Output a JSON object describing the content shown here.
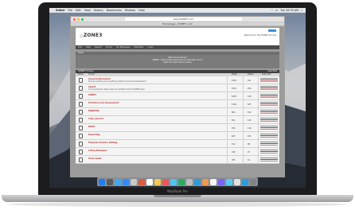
{
  "menubar": {
    "apple_icon": "apple-icon",
    "app": "Safari",
    "items": [
      "File",
      "Edit",
      "View",
      "History",
      "Bookmarks",
      "Window",
      "Help"
    ],
    "clock": "Tue 10:53 AM"
  },
  "browser": {
    "url": "www.ZONE3.com",
    "tab": "Homepage - ZONE3 .com"
  },
  "site": {
    "logo": "ZONE3",
    "welcome": "Welcome to the ZONE3 forums",
    "nav": [
      "FAQ",
      "Help",
      "Search",
      "Forum",
      "My Messages",
      "Members",
      "Login"
    ],
    "news_label": "News",
    "banner_lines": [
      "Welcome to Zone3!",
      "ZONE3 - Personal Development and Self Help Forum",
      "Read the rules before posting"
    ],
    "forum_title": "ZONE3 Forums",
    "forum_title_right": "Last Post",
    "columns": {
      "status": "Status",
      "forum": "Forum",
      "posts": "Posts",
      "topics": "Topics",
      "last_post": "Last post"
    }
  },
  "forums": [
    {
      "title": "General Discussion",
      "desc": "Discuss anything and everything related to personal development",
      "posts": "2345",
      "topics": "411"
    },
    {
      "title": "Latest",
      "desc": "Announcements, latest news and updates from the ZONE3 team",
      "posts": "1521",
      "topics": "254"
    },
    {
      "title": "ZONE3",
      "desc": "",
      "posts": "1287",
      "topics": "199"
    },
    {
      "title": "Practices and Assessment",
      "desc": "",
      "posts": "1102",
      "topics": "187"
    },
    {
      "title": "Eligibility",
      "desc": "",
      "posts": "904",
      "topics": "152"
    },
    {
      "title": "Clear Journal",
      "desc": "",
      "posts": "811",
      "topics": "134"
    },
    {
      "title": "MSGT",
      "desc": "",
      "posts": "702",
      "topics": "118"
    },
    {
      "title": "Reporting",
      "desc": "",
      "posts": "603",
      "topics": "101"
    },
    {
      "title": "Physical Practice Setting",
      "desc": "",
      "posts": "512",
      "topics": "88"
    },
    {
      "title": "Living Examples",
      "desc": "",
      "posts": "430",
      "topics": "72"
    },
    {
      "title": "Team Goals",
      "desc": "",
      "posts": "355",
      "topics": "61"
    }
  ],
  "laptop": {
    "brand": "MacBook Pro"
  },
  "colors": {
    "accent": "#b8332b",
    "login_button": "#3a8fd6",
    "nav_bg": "#4a4a4a"
  }
}
